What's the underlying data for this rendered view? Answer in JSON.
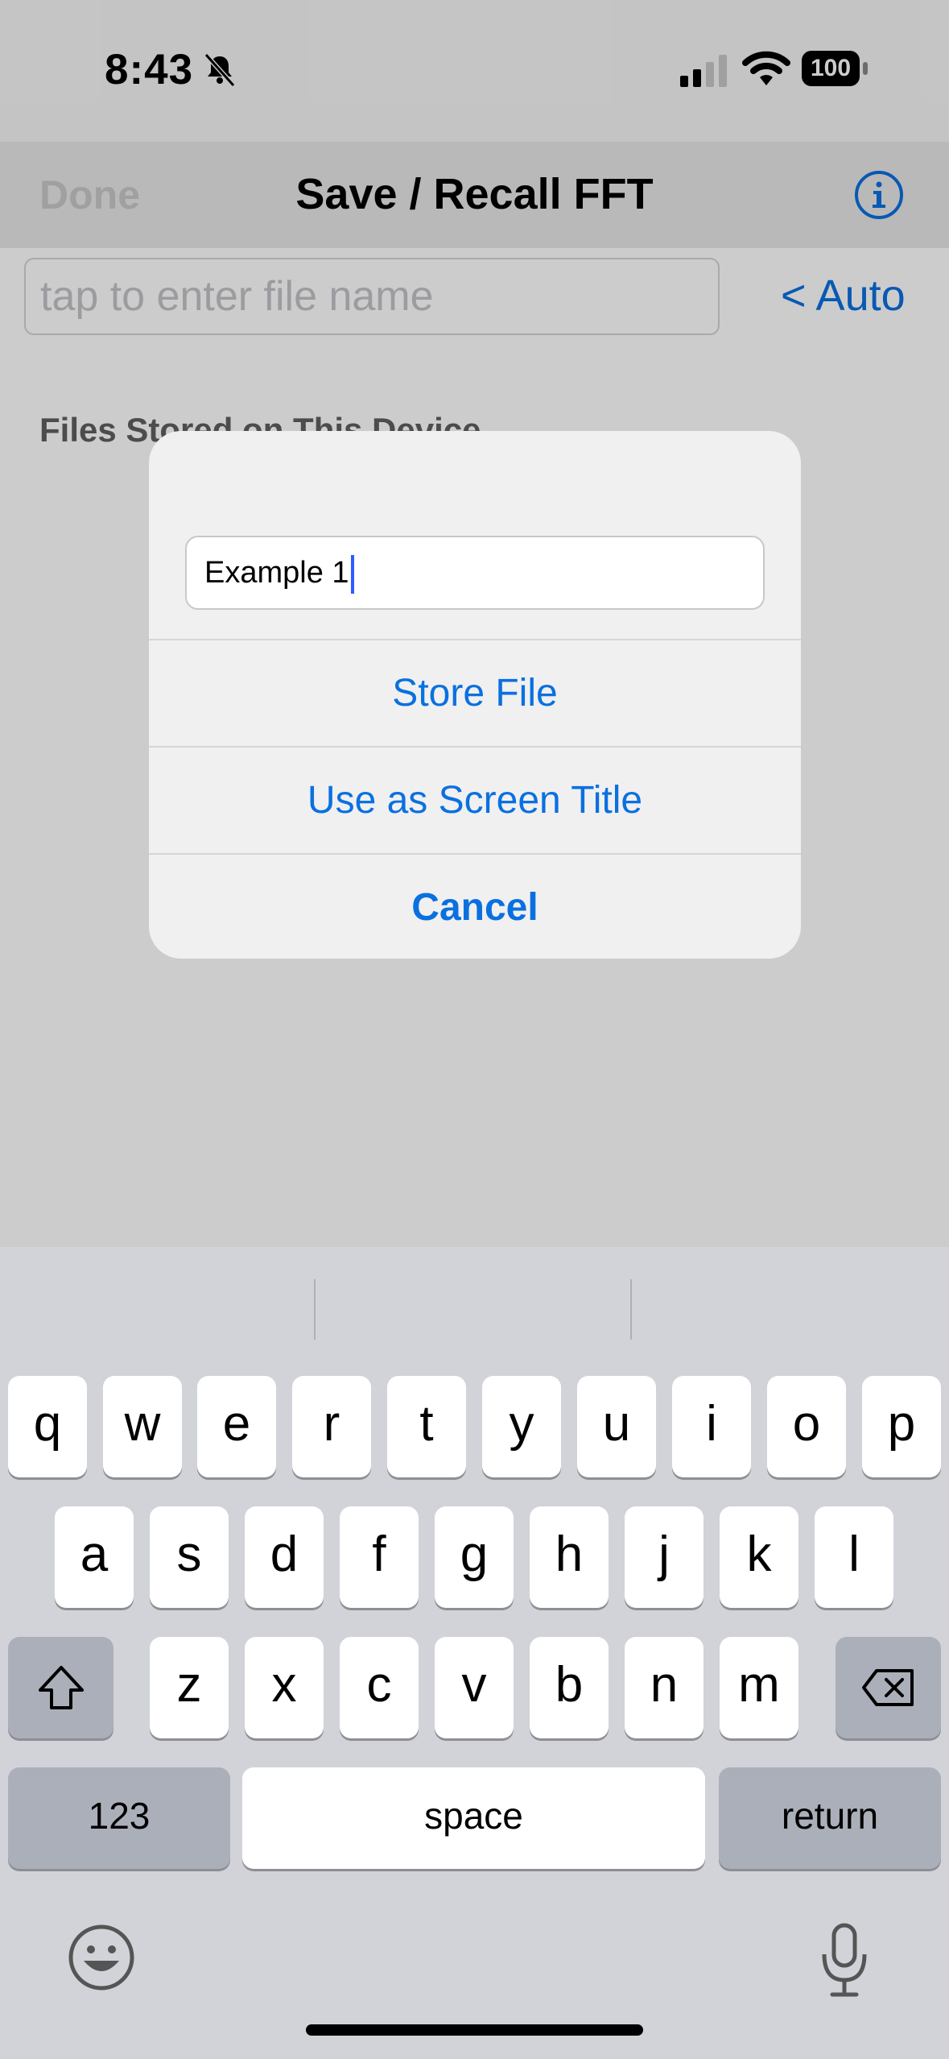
{
  "status_bar": {
    "time": "8:43",
    "battery": "100",
    "icons": [
      "bell-slash-icon",
      "cellular-signal-icon",
      "wifi-icon",
      "battery-icon"
    ]
  },
  "nav": {
    "done_label": "Done",
    "title": "Save / Recall FFT",
    "info_icon": "info-circle-icon"
  },
  "file_name_input": {
    "placeholder": "tap to enter file name"
  },
  "auto_button": "< Auto",
  "files_section_header": "Files Stored on This Device",
  "alert": {
    "field_value": "Example 1",
    "actions": {
      "store": "Store File",
      "use_title": "Use as Screen Title",
      "cancel": "Cancel"
    }
  },
  "keyboard": {
    "row1": [
      "q",
      "w",
      "e",
      "r",
      "t",
      "y",
      "u",
      "i",
      "o",
      "p"
    ],
    "row2": [
      "a",
      "s",
      "d",
      "f",
      "g",
      "h",
      "j",
      "k",
      "l"
    ],
    "row3": [
      "z",
      "x",
      "c",
      "v",
      "b",
      "n",
      "m"
    ],
    "numbers_label": "123",
    "space_label": "space",
    "return_label": "return",
    "icons": [
      "shift-icon",
      "delete-icon",
      "emoji-icon",
      "microphone-icon"
    ]
  },
  "colors": {
    "accent": "#0a70e0",
    "keyboard_bg": "#d1d3d9",
    "overlay": "rgba(0,0,0,0.2)"
  }
}
